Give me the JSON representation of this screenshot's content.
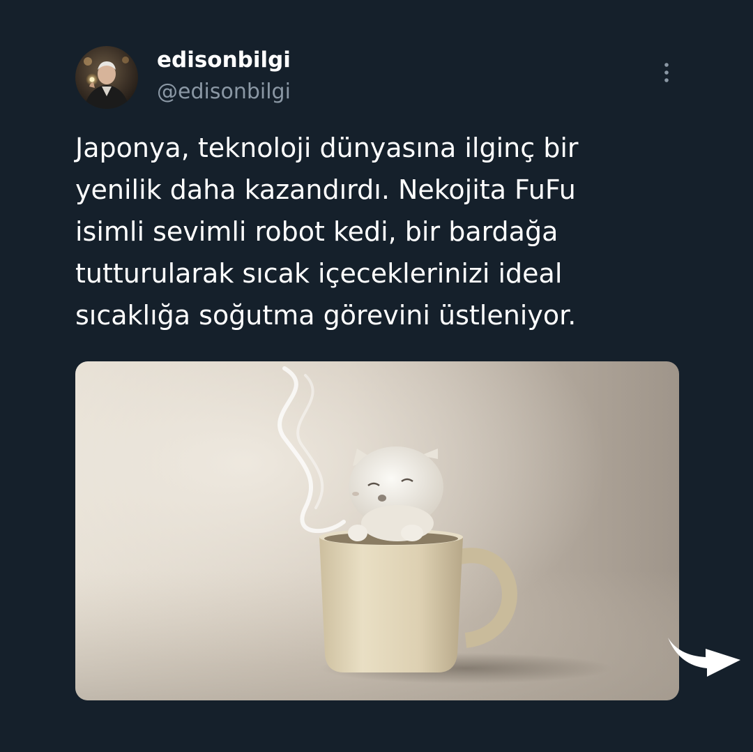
{
  "author": {
    "display_name": "edisonbilgi",
    "handle": "@edisonbilgi"
  },
  "tweet": {
    "text": "Japonya, teknoloji dünyasına ilginç bir\nyenilik daha kazandırdı. Nekojita FuFu\nisimli sevimli robot kedi, bir bardağa\ntutturularak sıcak içeceklerinizi ideal\nsıcaklığa soğutma görevini üstleniyor."
  },
  "icons": {
    "more": "more-vertical-icon",
    "next": "curved-arrow-right-icon"
  },
  "colors": {
    "background": "#15202b",
    "handle_text": "#8b98a5"
  }
}
